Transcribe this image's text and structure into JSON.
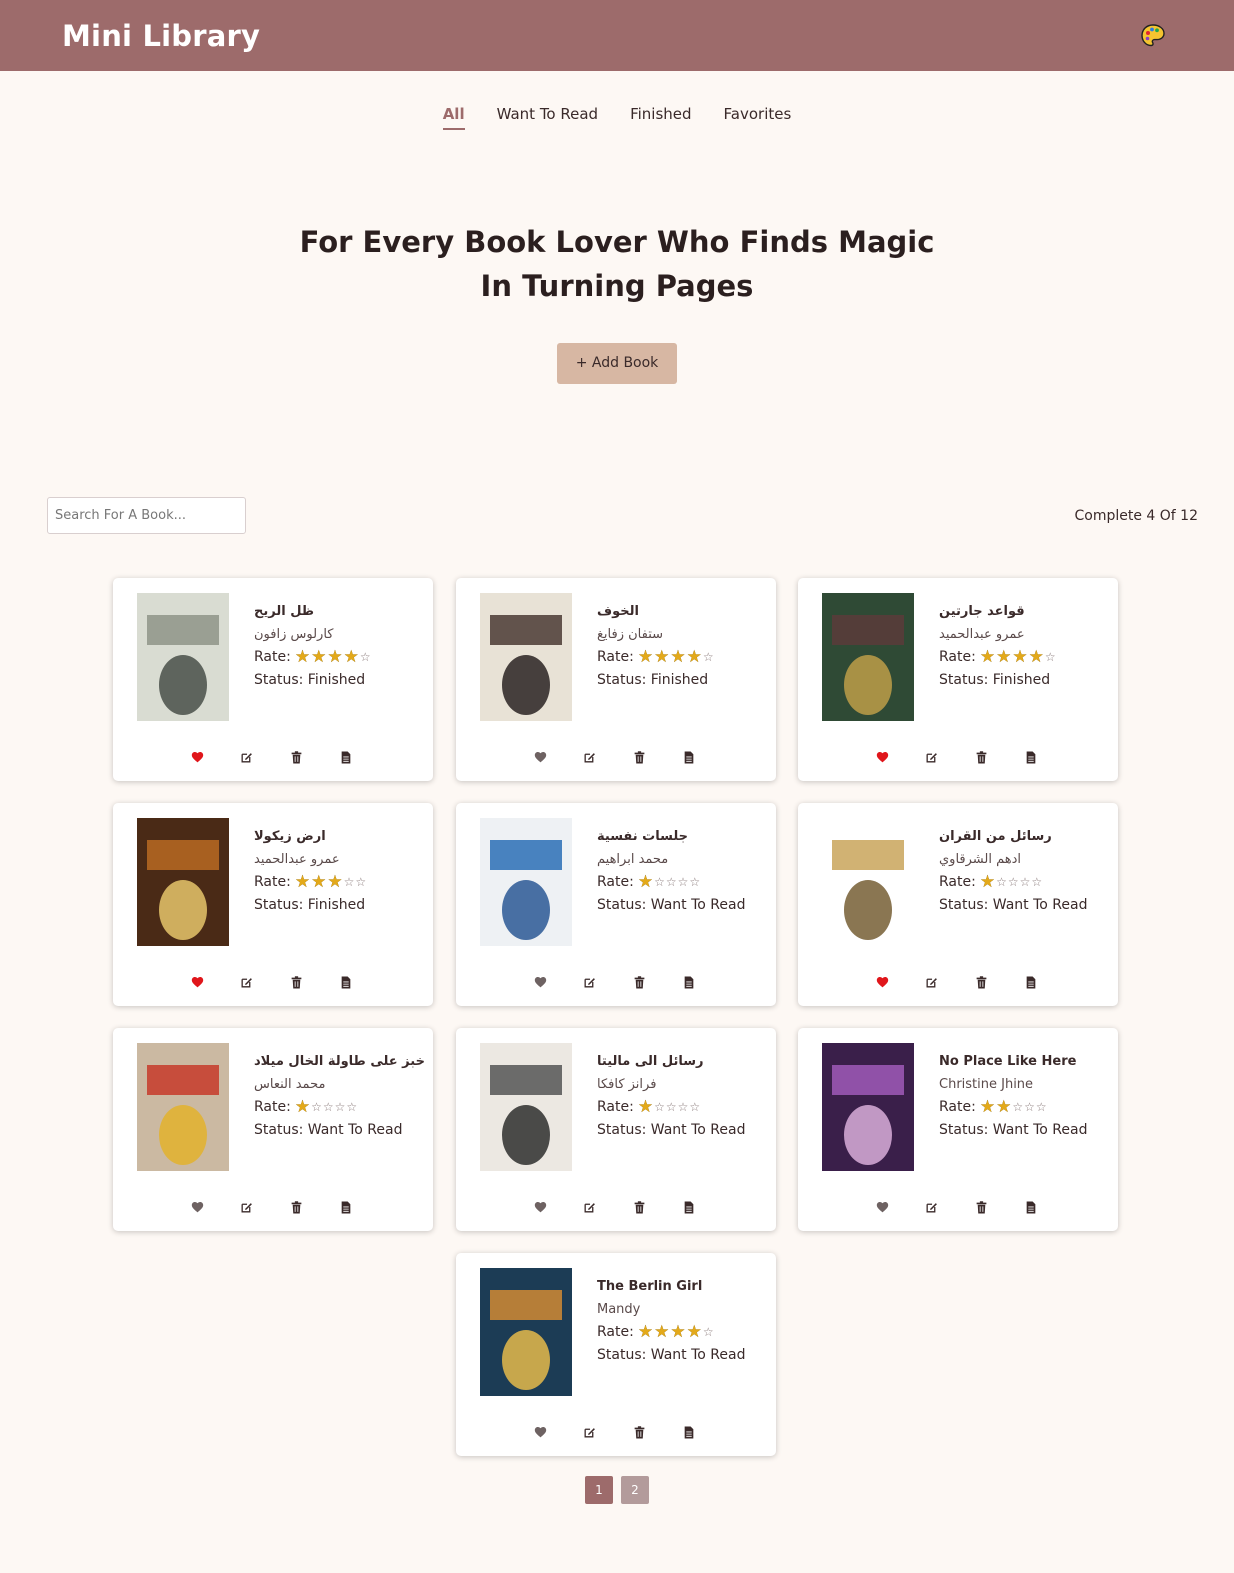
{
  "app": {
    "title": "Mini Library"
  },
  "nav": {
    "tabs": [
      {
        "label": "All",
        "active": true
      },
      {
        "label": "Want To Read",
        "active": false
      },
      {
        "label": "Finished",
        "active": false
      },
      {
        "label": "Favorites",
        "active": false
      }
    ]
  },
  "hero": {
    "title": "For Every Book Lover Who Finds Magic In Turning Pages",
    "add_button": "+ Add Book"
  },
  "search": {
    "placeholder": "Search For A Book..."
  },
  "progress": {
    "text": "Complete 4 Of 12",
    "completed": 4,
    "total": 12
  },
  "labels": {
    "rate": "Rate:",
    "status_prefix": "Status:"
  },
  "colors": {
    "header": "#9d6b6b",
    "accent": "#d7b7a3",
    "favorite": "#e0161b",
    "star": "#e3a91a"
  },
  "books": [
    {
      "title": "ظل الريح",
      "author": "كارلوس زافون",
      "rating": 4,
      "status": "Finished",
      "favorite": true,
      "rtl": true
    },
    {
      "title": "الخوف",
      "author": "ستفان زفايغ",
      "rating": 4,
      "status": "Finished",
      "favorite": false,
      "rtl": true
    },
    {
      "title": "قواعد جارتين",
      "author": "عمرو عبدالحميد",
      "rating": 4,
      "status": "Finished",
      "favorite": true,
      "rtl": true
    },
    {
      "title": "ارض زيكولا",
      "author": "عمرو عبدالحميد",
      "rating": 3,
      "status": "Finished",
      "favorite": true,
      "rtl": true
    },
    {
      "title": "جلسات نفسية",
      "author": "محمد ابراهيم",
      "rating": 1,
      "status": "Want To Read",
      "favorite": false,
      "rtl": true
    },
    {
      "title": "رسائل من القران",
      "author": "ادهم الشرقاوي",
      "rating": 1,
      "status": "Want To Read",
      "favorite": true,
      "rtl": true
    },
    {
      "title": "خبز على طاولة الخال ميلاد",
      "author": "محمد النعاس",
      "rating": 1,
      "status": "Want To Read",
      "favorite": false,
      "rtl": true
    },
    {
      "title": "رسائل الى ماليتا",
      "author": "فرانز كافكا",
      "rating": 1,
      "status": "Want To Read",
      "favorite": false,
      "rtl": true
    },
    {
      "title": "No Place Like Here",
      "author": "Christine Jhine",
      "rating": 2,
      "status": "Want To Read",
      "favorite": false,
      "rtl": false
    },
    {
      "title": "The Berlin Girl",
      "author": "Mandy",
      "rating": 4,
      "status": "Want To Read",
      "favorite": false,
      "rtl": false
    }
  ],
  "pagination": {
    "pages": [
      "1",
      "2"
    ],
    "current": "1"
  }
}
